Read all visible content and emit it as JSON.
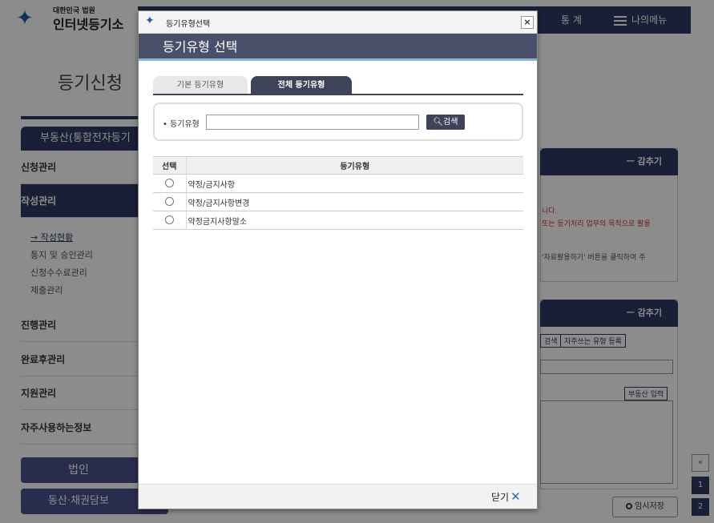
{
  "background": {
    "logo": {
      "small": "대한민국 법원",
      "big": "인터넷등기소"
    },
    "nav": {
      "stats": "통 계",
      "menu": "나의메뉴"
    },
    "page_title": "등기신청",
    "sidebar": {
      "heading": "부동산(통합전자등기",
      "items": [
        {
          "label": "신청관리"
        },
        {
          "label": "작성관리"
        },
        {
          "label": "진행관리"
        },
        {
          "label": "완료후관리"
        },
        {
          "label": "지원관리"
        },
        {
          "label": "자주사용하는정보"
        }
      ],
      "sub_items": [
        "→ 작성현황",
        "통지 및 승인관리",
        "신청수수료관리",
        "제출관리"
      ]
    },
    "buttons": {
      "corp": "법인",
      "movable": "동산·채권담보"
    },
    "panel1": {
      "collapse": "ㅡ 감추기",
      "text1": "니다.",
      "text2": "또는 등기처리 업무의 목적으로 활용",
      "text3": "'자료활용하기' 버튼을 클릭하여 주"
    },
    "panel2": {
      "collapse": "ㅡ 감추기",
      "search": "검색",
      "freq": "자주쓰는 유형 등록",
      "realestate": "부동산 입력"
    },
    "temp_save": "임시저장",
    "scroll_top": "«",
    "pages": [
      "1",
      "2"
    ]
  },
  "modal": {
    "window_title": "등기유형선택",
    "close_x": "×",
    "header": "등기유형 선택",
    "tabs": [
      {
        "label": "기본 등기유형",
        "active": false
      },
      {
        "label": "전체 등기유형",
        "active": true
      }
    ],
    "search": {
      "label": "• 등기유형",
      "value": "",
      "button": "검색"
    },
    "table": {
      "columns": [
        "선택",
        "등기유형"
      ],
      "rows": [
        {
          "type": "약정/금지사항"
        },
        {
          "type": "약정/금지사항변경"
        },
        {
          "type": "약정금지사항말소"
        }
      ]
    },
    "close_button": "닫기"
  },
  "colors": {
    "navy": "#2e3a63",
    "modal_header": "#4a4f6a",
    "accent": "#8fb3d9"
  }
}
